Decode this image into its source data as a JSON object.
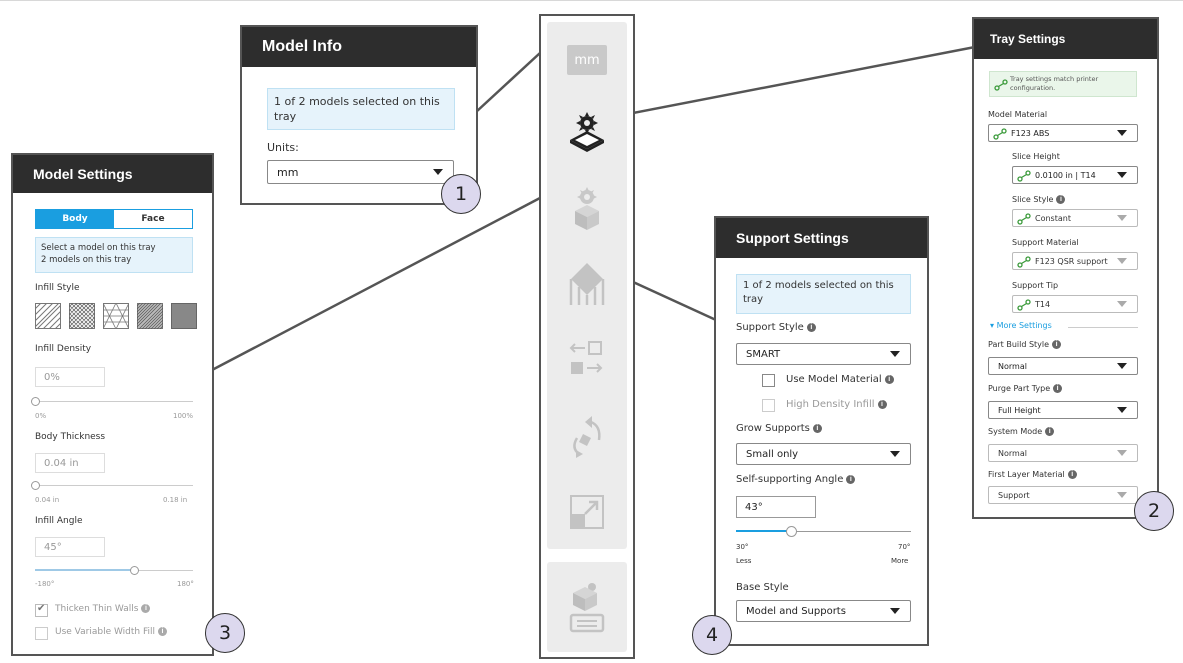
{
  "model_info": {
    "title": "Model Info",
    "info_text": "1 of 2 models selected on this tray",
    "units_label": "Units:",
    "units_value": "mm",
    "callout": "1"
  },
  "tray_settings": {
    "title": "Tray Settings",
    "match_text": "Tray settings match printer configuration.",
    "model_material_label": "Model Material",
    "model_material_value": "F123 ABS",
    "slice_height_label": "Slice Height",
    "slice_height_value": "0.0100 in | T14",
    "slice_style_label": "Slice Style",
    "slice_style_value": "Constant",
    "support_material_label": "Support Material",
    "support_material_value": "F123 QSR support",
    "support_tip_label": "Support Tip",
    "support_tip_value": "T14",
    "more_settings_label": "More Settings",
    "part_build_style_label": "Part Build Style",
    "part_build_style_value": "Normal",
    "purge_part_type_label": "Purge Part Type",
    "purge_part_type_value": "Full Height",
    "system_mode_label": "System Mode",
    "system_mode_value": "Normal",
    "first_layer_material_label": "First Layer Material",
    "first_layer_material_value": "Support",
    "callout": "2"
  },
  "model_settings": {
    "title": "Model Settings",
    "tab_body": "Body",
    "tab_face": "Face",
    "info_line1": "Select a model on this tray",
    "info_line2": "2 models on this tray",
    "infill_style_label": "Infill Style",
    "infill_density_label": "Infill Density",
    "infill_density_value": "0%",
    "infill_density_min": "0%",
    "infill_density_max": "100%",
    "body_thickness_label": "Body Thickness",
    "body_thickness_value": "0.04 in",
    "body_thickness_min": "0.04 in",
    "body_thickness_max": "0.18 in",
    "infill_angle_label": "Infill Angle",
    "infill_angle_value": "45°",
    "infill_angle_min": "-180°",
    "infill_angle_max": "180°",
    "thicken_label": "Thicken Thin Walls",
    "variable_label": "Use Variable Width Fill",
    "callout": "3"
  },
  "support_settings": {
    "title": "Support Settings",
    "info_text": "1 of 2 models selected on this tray",
    "support_style_label": "Support Style",
    "support_style_value": "SMART",
    "use_model_material_label": "Use Model Material",
    "high_density_label": "High Density Infill",
    "grow_supports_label": "Grow Supports",
    "grow_supports_value": "Small only",
    "angle_label": "Self-supporting Angle",
    "angle_value": "43°",
    "angle_min": "30°",
    "angle_max": "70°",
    "angle_min_word": "Less",
    "angle_max_word": "More",
    "base_style_label": "Base Style",
    "base_style_value": "Model and Supports",
    "callout": "4"
  },
  "toolbar": {
    "units_button": "mm",
    "tools": [
      "tray-settings-icon",
      "model-settings-icon",
      "support-settings-icon",
      "arrange-icon",
      "orient-icon",
      "scale-icon",
      "build-icon"
    ]
  },
  "colors": {
    "header_bg": "#2d2d2d",
    "accent_blue": "#1a9ee0",
    "info_bg": "#e6f3fb",
    "link_green": "#3a9a3a",
    "callout_bg": "#dcd8ee"
  }
}
